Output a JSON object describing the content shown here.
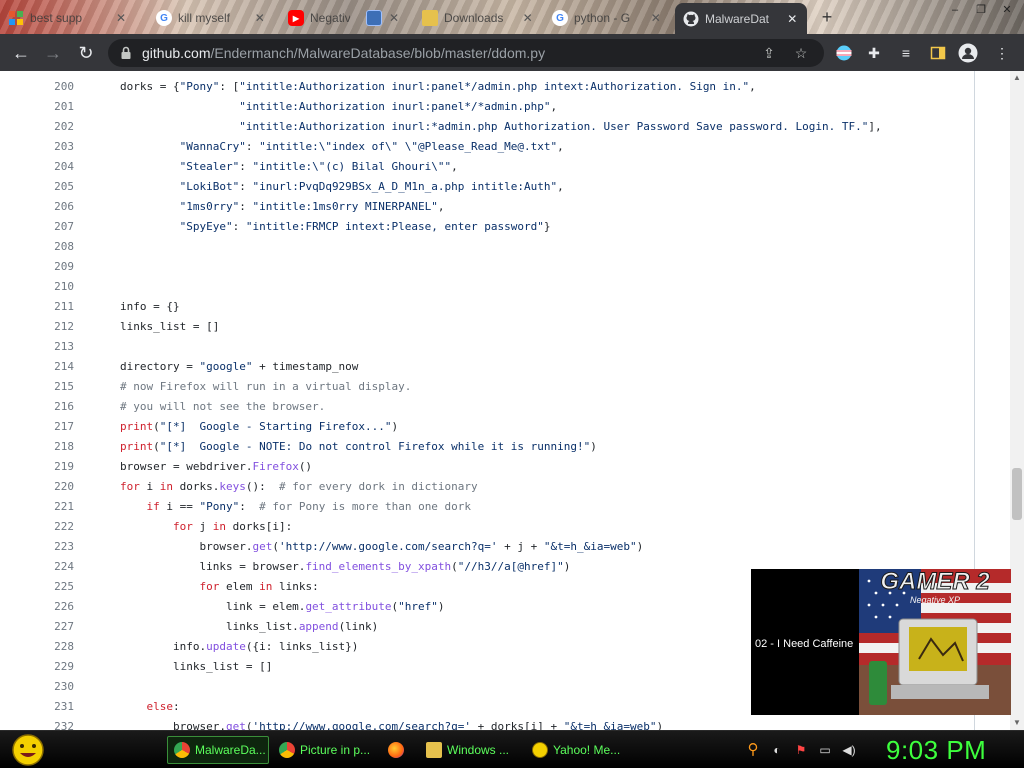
{
  "browser": {
    "tabs": [
      {
        "title": "best supp",
        "favicon": "windows-logo-icon"
      },
      {
        "title": "kill myself",
        "favicon": "google-icon"
      },
      {
        "title": "Negative",
        "favicon": "youtube-icon"
      },
      {
        "title": "",
        "favicon": "window-icon"
      },
      {
        "title": "Downloads",
        "favicon": "folder-icon"
      },
      {
        "title": "python - G",
        "favicon": "google-icon"
      },
      {
        "title": "MalwareDat",
        "favicon": "github-icon",
        "active": true
      }
    ],
    "new_tab": "+",
    "window_buttons": [
      "–",
      "❐",
      "✕"
    ],
    "url": {
      "host": "github.com",
      "path": "/Endermanch/MalwareDatabase/blob/master/ddom.py"
    }
  },
  "code": {
    "lines": [
      {
        "n": 200,
        "text": "dorks = {\"Pony\": [\"intitle:Authorization inurl:panel*/admin.php intext:Authorization. Sign in.\","
      },
      {
        "n": 201,
        "text": "                  \"intitle:Authorization inurl:panel*/*admin.php\","
      },
      {
        "n": 202,
        "text": "                  \"intitle:Authorization inurl:*admin.php Authorization. User Password Save password. Login. TF.\"],"
      },
      {
        "n": 203,
        "text": "         \"WannaCry\": \"intitle:\\\"index of\\\" \\\"@Please_Read_Me@.txt\","
      },
      {
        "n": 204,
        "text": "         \"Stealer\": \"intitle:\\\"(c) Bilal Ghouri\\\"\","
      },
      {
        "n": 205,
        "text": "         \"LokiBot\": \"inurl:PvqDq929BSx_A_D_M1n_a.php intitle:Auth\","
      },
      {
        "n": 206,
        "text": "         \"1ms0rry\": \"intitle:1ms0rry MINERPANEL\","
      },
      {
        "n": 207,
        "text": "         \"SpyEye\": \"intitle:FRMCP intext:Please, enter password\"}"
      },
      {
        "n": 208,
        "text": ""
      },
      {
        "n": 209,
        "text": ""
      },
      {
        "n": 210,
        "text": ""
      },
      {
        "n": 211,
        "text": "info = {}"
      },
      {
        "n": 212,
        "text": "links_list = []"
      },
      {
        "n": 213,
        "text": ""
      },
      {
        "n": 214,
        "text": "directory = \"google\" + timestamp_now"
      },
      {
        "n": 215,
        "text": "# now Firefox will run in a virtual display."
      },
      {
        "n": 216,
        "text": "# you will not see the browser."
      },
      {
        "n": 217,
        "text": "print(\"[*]  Google - Starting Firefox...\")"
      },
      {
        "n": 218,
        "text": "print(\"[*]  Google - NOTE: Do not control Firefox while it is running!\")"
      },
      {
        "n": 219,
        "text": "browser = webdriver.Firefox()"
      },
      {
        "n": 220,
        "text": "for i in dorks.keys():  # for every dork in dictionary"
      },
      {
        "n": 221,
        "text": "    if i == \"Pony\":  # for Pony is more than one dork"
      },
      {
        "n": 222,
        "text": "        for j in dorks[i]:"
      },
      {
        "n": 223,
        "text": "            browser.get('http://www.google.com/search?q=' + j + \"&t=h_&ia=web\")"
      },
      {
        "n": 224,
        "text": "            links = browser.find_elements_by_xpath(\"//h3//a[@href]\")"
      },
      {
        "n": 225,
        "text": "            for elem in links:"
      },
      {
        "n": 226,
        "text": "                link = elem.get_attribute(\"href\")"
      },
      {
        "n": 227,
        "text": "                links_list.append(link)"
      },
      {
        "n": 228,
        "text": "        info.update({i: links_list})"
      },
      {
        "n": 229,
        "text": "        links_list = []"
      },
      {
        "n": 230,
        "text": ""
      },
      {
        "n": 231,
        "text": "    else:"
      },
      {
        "n": 232,
        "text": "        browser.get('http://www.google.com/search?q=' + dorks[i] + \"&t=h_&ia=web\")"
      }
    ]
  },
  "pip": {
    "track": "02 - I Need Caffeine",
    "album_title": "GAMER 2",
    "album_subtitle": "Negative XP"
  },
  "taskbar": {
    "items": [
      {
        "label": "MalwareDa...",
        "icon": "chrome-icon",
        "active": true
      },
      {
        "label": "Picture in p...",
        "icon": "chrome-icon"
      },
      {
        "label": "",
        "icon": "firefox-icon"
      },
      {
        "label": "Windows ...",
        "icon": "folder-icon"
      },
      {
        "label": "Yahoo! Me...",
        "icon": "yahoo-messenger-icon"
      }
    ],
    "clock": "9:03 PM"
  },
  "colors": {
    "keyword": "#cf222e",
    "function": "#8250df",
    "comment": "#6e7781",
    "taskbar_text": "#5cff5c",
    "clock": "#3dff3d"
  }
}
